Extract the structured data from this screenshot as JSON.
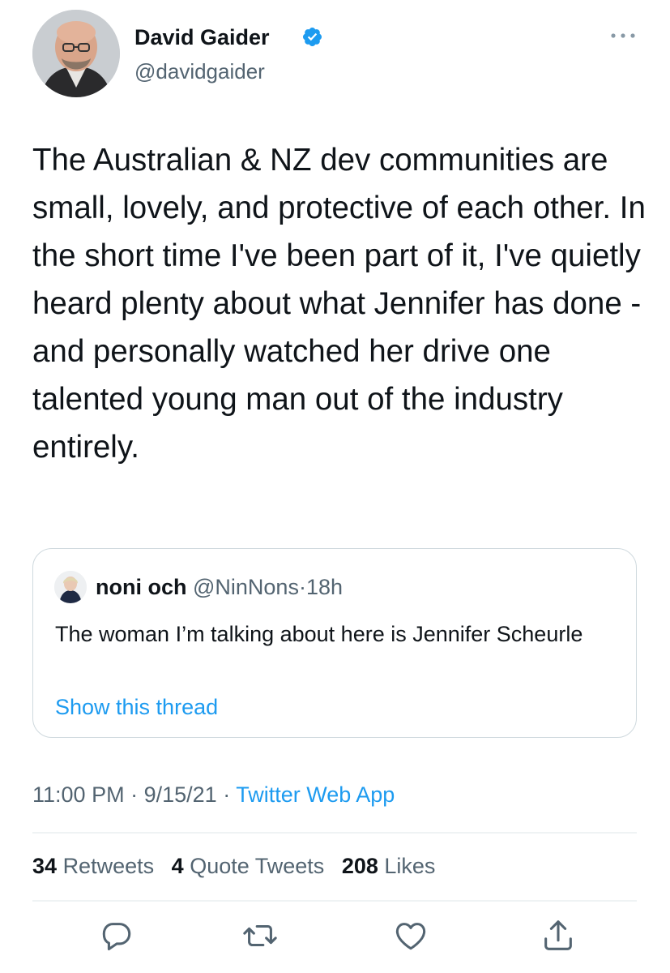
{
  "author": {
    "display_name": "David Gaider",
    "handle": "@davidgaider",
    "verified": true,
    "avatar_icon": "avatar-photo"
  },
  "tweet": {
    "text": "The Australian & NZ dev communities are small, lovely, and protective of each other. In the short time I've been part of it, I've quietly heard plenty about what Jennifer has done - and personally watched her drive one talented young man out of the industry entirely."
  },
  "quoted_tweet": {
    "display_name": "noni och",
    "handle": "@NinNons",
    "separator": "·",
    "time_ago": "18h",
    "text": "The woman I’m talking about here is Jennifer Scheurle",
    "show_thread_label": "Show this thread"
  },
  "meta": {
    "time": "11:00 PM",
    "separator1": "·",
    "date": "9/15/21",
    "separator2": "·",
    "source": "Twitter Web App"
  },
  "stats": {
    "retweets_count": "34",
    "retweets_label": "Retweets",
    "quotes_count": "4",
    "quotes_label": "Quote Tweets",
    "likes_count": "208",
    "likes_label": "Likes"
  },
  "actions": [
    "reply-icon",
    "retweet-icon",
    "like-icon",
    "share-icon"
  ],
  "colors": {
    "accent": "#1d9bf0",
    "secondary_text": "#536471",
    "primary_text": "#0f1419",
    "border": "#cfd9de"
  }
}
